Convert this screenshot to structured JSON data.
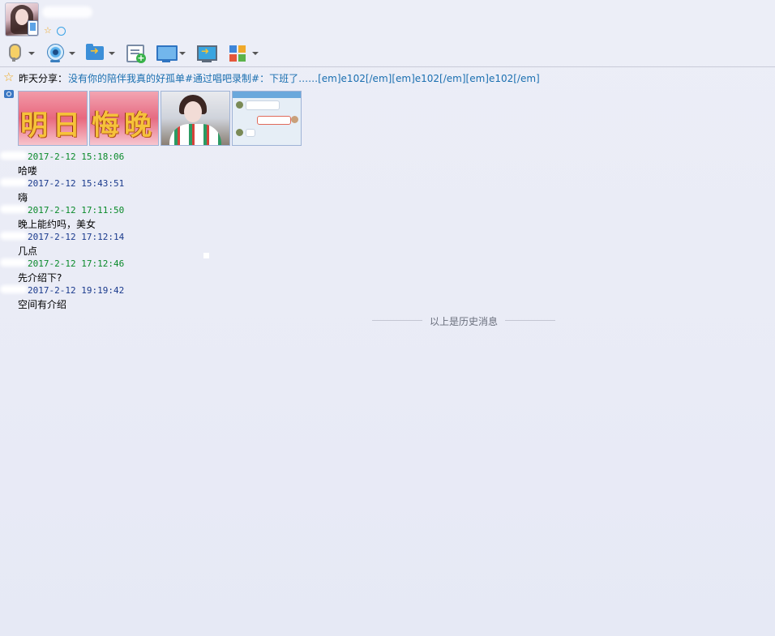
{
  "toolbar": {
    "buttons": [
      {
        "name": "voice-call",
        "icon": "microphone-icon",
        "has_dropdown": true
      },
      {
        "name": "video-call",
        "icon": "webcam-icon",
        "has_dropdown": true
      },
      {
        "name": "send-file",
        "icon": "folder-transfer-icon",
        "has_dropdown": true
      },
      {
        "name": "create-discussion",
        "icon": "message-add-icon",
        "has_dropdown": false
      },
      {
        "name": "remote-assist",
        "icon": "screen-share-icon",
        "has_dropdown": true
      },
      {
        "name": "share-screen",
        "icon": "screen-forward-icon",
        "has_dropdown": false
      },
      {
        "name": "apps",
        "icon": "apps-grid-icon",
        "has_dropdown": true
      }
    ]
  },
  "share": {
    "label": "昨天分享：",
    "text": "没有你的陪伴我真的好孤单#通过唱吧录制#：下班了……[em]e102[/em][em]e102[/em][em]e102[/em]"
  },
  "album": {
    "thumbnails": [
      {
        "name": "photo-1"
      },
      {
        "name": "photo-2"
      },
      {
        "name": "photo-3"
      },
      {
        "name": "photo-4"
      }
    ]
  },
  "messages": [
    {
      "time": "2017-2-12 15:18:06",
      "text": "哈喽",
      "side": "peer"
    },
    {
      "time": "2017-2-12 15:43:51",
      "text": "嗨",
      "side": "self"
    },
    {
      "time": "2017-2-12 17:11:50",
      "text": "晚上能约吗，美女",
      "side": "peer"
    },
    {
      "time": "2017-2-12 17:12:14",
      "text": "几点",
      "side": "self"
    },
    {
      "time": "2017-2-12 17:12:46",
      "text": "先介绍下?",
      "side": "peer"
    },
    {
      "time": "2017-2-12 19:19:42",
      "text": "空间有介绍",
      "side": "self"
    }
  ],
  "history_divider": "以上是历史消息",
  "colors": {
    "peer_time": "#0a8a2a",
    "self_time": "#1a3a8c",
    "share_link": "#1a6fb0",
    "background": "#eceef7"
  }
}
